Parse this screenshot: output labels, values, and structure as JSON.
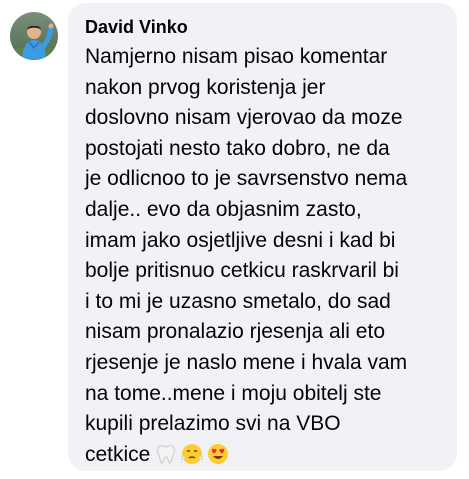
{
  "comment": {
    "author": "David Vinko",
    "text": "Namjerno nisam pisao komentar\nnakon prvog koristenja jer\ndoslovno nisam vjerovao da moze\npostojati nesto tako dobro, ne da\nje odlicnoo to je savrsenstvo nema\ndalje.. evo da objasnim zasto,\nimam jako osjetljive desni i kad bi\nbolje pritisnuo cetkicu raskrvaril bi\ni to mi je uzasno smetalo, do sad\nnisam pronalazio rjesenja ali eto\nrjesenje je naslo mene i hvala vam\nna tome..mene i moju obitelj ste\nkupili prelazimo svi na VBO\ncetkice",
    "emojis": [
      "tooth-emoji",
      "face-with-steam-emoji",
      "heart-eyes-emoji"
    ]
  },
  "colors": {
    "bubble_bg": "#f0f2f5",
    "text": "#050505"
  }
}
